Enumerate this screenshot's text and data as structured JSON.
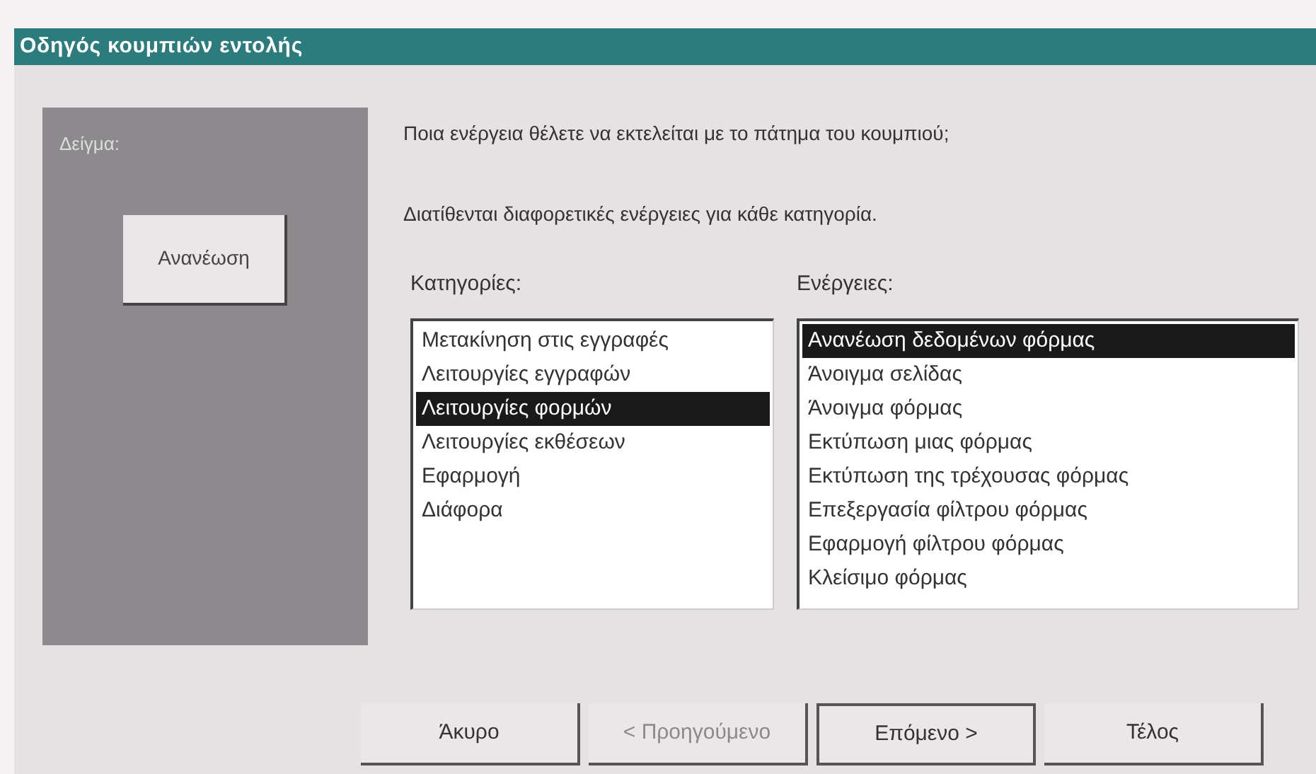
{
  "window": {
    "title": "Οδηγός κουμπιών εντολής"
  },
  "sample": {
    "label": "Δείγμα:",
    "button": "Ανανέωση"
  },
  "question": "Ποια ενέργεια θέλετε να εκτελείται με το πάτημα του κουμπιού;",
  "hint": "Διατίθενται διαφορετικές ενέργειες για κάθε κατηγορία.",
  "categories": {
    "label": "Κατηγορίες:",
    "items": [
      {
        "text": "Μετακίνηση στις εγγραφές",
        "selected": false
      },
      {
        "text": "Λειτουργίες εγγραφών",
        "selected": false
      },
      {
        "text": "Λειτουργίες φορμών",
        "selected": true
      },
      {
        "text": "Λειτουργίες εκθέσεων",
        "selected": false
      },
      {
        "text": "Εφαρμογή",
        "selected": false
      },
      {
        "text": "Διάφορα",
        "selected": false
      }
    ]
  },
  "actions": {
    "label": "Ενέργειες:",
    "items": [
      {
        "text": "Ανανέωση δεδομένων φόρμας",
        "selected": true
      },
      {
        "text": "Άνοιγμα σελίδας",
        "selected": false
      },
      {
        "text": "Άνοιγμα φόρμας",
        "selected": false
      },
      {
        "text": "Εκτύπωση μιας φόρμας",
        "selected": false
      },
      {
        "text": "Εκτύπωση της τρέχουσας φόρμας",
        "selected": false
      },
      {
        "text": "Επεξεργασία φίλτρου φόρμας",
        "selected": false
      },
      {
        "text": "Εφαρμογή φίλτρου φόρμας",
        "selected": false
      },
      {
        "text": "Κλείσιμο φόρμας",
        "selected": false
      }
    ]
  },
  "buttons": [
    {
      "label": "Άκυρο",
      "disabled": false,
      "default": false
    },
    {
      "label": "< Προηγούμενο",
      "disabled": true,
      "default": false
    },
    {
      "label": "Επόμενο >",
      "disabled": false,
      "default": true
    },
    {
      "label": "Τέλος",
      "disabled": false,
      "default": false
    }
  ]
}
